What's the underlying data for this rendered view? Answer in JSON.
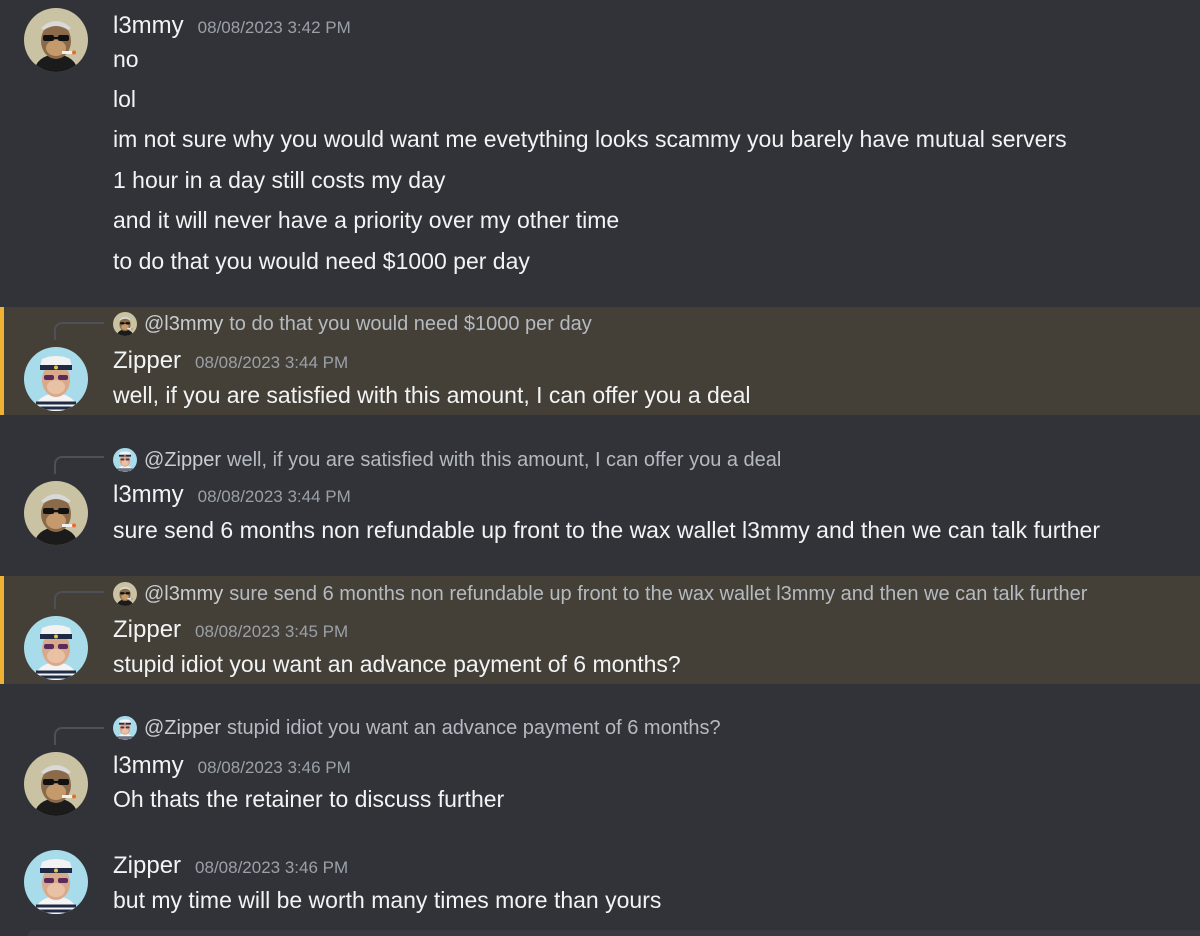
{
  "colors": {
    "background": "#313338",
    "mention_background": "#444037",
    "mention_bar": "#f0b232",
    "text": "#f2f3f5",
    "muted": "#9ba0a8"
  },
  "users": {
    "l3mmy": {
      "name": "l3mmy",
      "avatar_icon": "ape-avatar-icon"
    },
    "zipper": {
      "name": "Zipper",
      "avatar_icon": "ape-sailor-avatar-icon"
    }
  },
  "messages": [
    {
      "author": "l3mmy",
      "timestamp": "08/08/2023 3:42 PM",
      "lines": [
        "no",
        "lol",
        "im not sure why you would want me evetything looks scammy you barely have mutual servers",
        "1 hour in a day still costs my day",
        "and it will never have a priority over my other time",
        "to do that you would need $1000 per day"
      ]
    },
    {
      "author": "Zipper",
      "timestamp": "08/08/2023 3:44 PM",
      "reply_to": "@l3mmy",
      "reply_text": "to do that you would need $1000 per day",
      "lines": [
        "well, if you are satisfied with this amount, I can offer you a deal"
      ]
    },
    {
      "author": "l3mmy",
      "timestamp": "08/08/2023 3:44 PM",
      "reply_to": "@Zipper",
      "reply_text": "well, if you are satisfied with this amount, I can offer you a deal",
      "lines": [
        "sure send 6 months non refundable up front to the wax wallet l3mmy and then we can talk further"
      ]
    },
    {
      "author": "Zipper",
      "timestamp": "08/08/2023 3:45 PM",
      "reply_to": "@l3mmy",
      "reply_text": "sure send 6 months non refundable up front to the wax wallet l3mmy and then we can talk further",
      "lines": [
        "stupid idiot you want an advance payment of 6 months?"
      ]
    },
    {
      "author": "l3mmy",
      "timestamp": "08/08/2023 3:46 PM",
      "reply_to": "@Zipper",
      "reply_text": "stupid idiot you want an advance payment of 6 months?",
      "lines": [
        "Oh thats the retainer to discuss further"
      ]
    },
    {
      "author": "Zipper",
      "timestamp": "08/08/2023 3:46 PM",
      "lines": [
        "but my time will be worth many times more than yours"
      ]
    }
  ]
}
